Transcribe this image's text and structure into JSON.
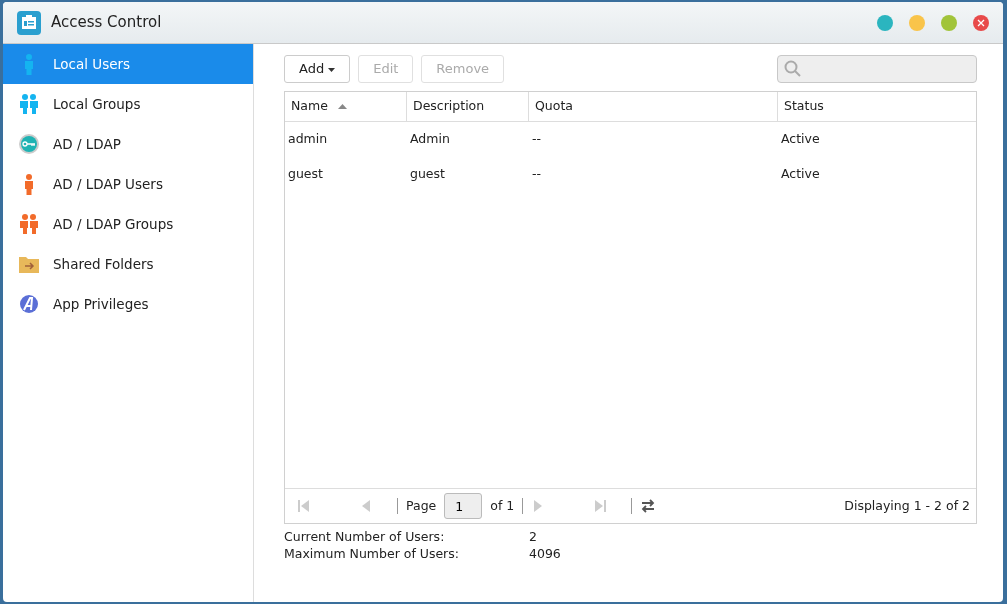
{
  "window": {
    "title": "Access Control",
    "controls": [
      {
        "kind": "dot",
        "color": "#2bb5bf"
      },
      {
        "kind": "dot",
        "color": "#f9c44a"
      },
      {
        "kind": "dot",
        "color": "#a1c43a"
      },
      {
        "kind": "close",
        "color": "#e84a4a"
      }
    ]
  },
  "sidebar": {
    "items": [
      {
        "label": "Local Users",
        "kind": "user",
        "color": "#14b4f0",
        "selected": true
      },
      {
        "label": "Local Groups",
        "kind": "group",
        "color": "#14b4f0",
        "selected": false
      },
      {
        "label": "AD / LDAP",
        "kind": "key",
        "color": "#1fb3b3",
        "selected": false
      },
      {
        "label": "AD / LDAP Users",
        "kind": "user",
        "color": "#f26b2a",
        "selected": false
      },
      {
        "label": "AD / LDAP Groups",
        "kind": "group",
        "color": "#f26b2a",
        "selected": false
      },
      {
        "label": "Shared Folders",
        "kind": "folder",
        "color": "#e8b85a",
        "selected": false
      },
      {
        "label": "App Privileges",
        "kind": "app",
        "color": "#5b6fd6",
        "selected": false
      }
    ]
  },
  "toolbar": {
    "buttons": [
      {
        "label": "Add",
        "dropdown": true,
        "disabled": false
      },
      {
        "label": "Edit",
        "dropdown": false,
        "disabled": true
      },
      {
        "label": "Remove",
        "dropdown": false,
        "disabled": true
      }
    ]
  },
  "table": {
    "columns": [
      {
        "label": "Name",
        "sorted": true
      },
      {
        "label": "Description",
        "sorted": false
      },
      {
        "label": "Quota",
        "sorted": false
      },
      {
        "label": "Status",
        "sorted": false
      }
    ],
    "rows": [
      [
        "admin",
        "Admin",
        "--",
        "Active"
      ],
      [
        "guest",
        "guest",
        "--",
        "Active"
      ]
    ]
  },
  "pager": {
    "nav_disabled": true,
    "page_label": "Page",
    "page": "1",
    "of": "of 1",
    "displaying": "Displaying 1 - 2 of 2"
  },
  "stats": [
    {
      "label": "Current Number of Users:",
      "value": "2"
    },
    {
      "label": "Maximum Number of Users:",
      "value": "4096"
    }
  ]
}
